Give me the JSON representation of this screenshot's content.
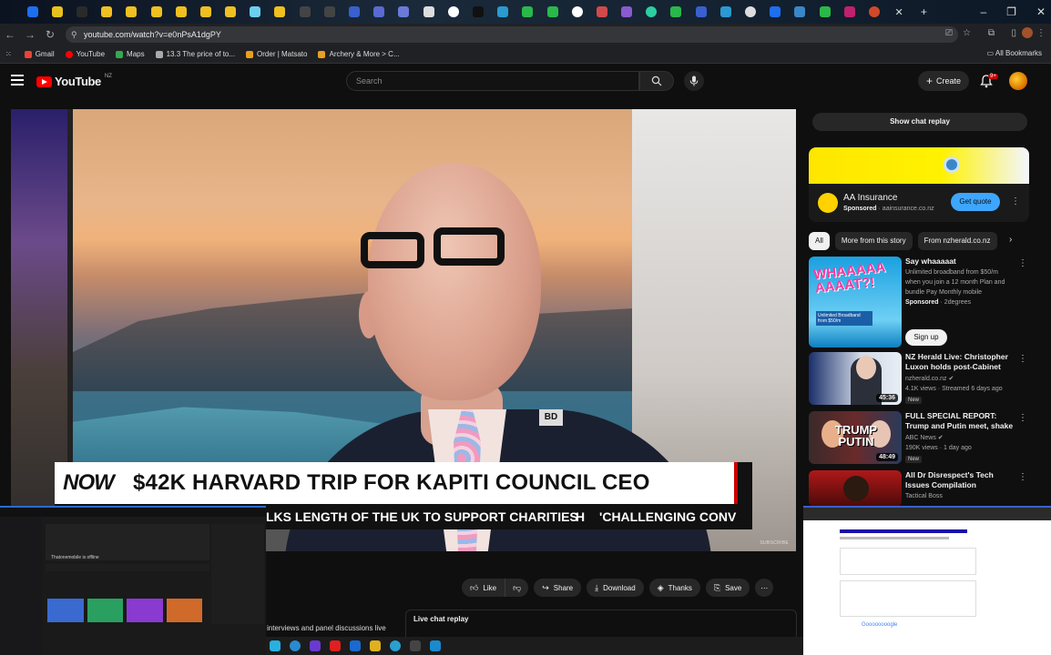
{
  "browser": {
    "url": "youtube.com/watch?v=e0nPsA1dgPY",
    "bookmarks": [
      "Gmail",
      "YouTube",
      "Maps",
      "13.3 The price of to...",
      "Order | Matsato",
      "Archery & More > C..."
    ],
    "all_bookmarks": "All Bookmarks"
  },
  "header": {
    "logo": "YouTube",
    "region": "NZ",
    "search_placeholder": "Search",
    "create_label": "Create",
    "notifications_badge": "9+"
  },
  "video": {
    "badge": "NOW",
    "headline": "$42K HARVARD TRIP FOR KAPITI COUNCIL CEO",
    "ticker_a": "LKS LENGTH OF THE UK TO SUPPORT CHARITIES",
    "ticker_b": "'CHALLENGING CONV",
    "ticker_logo": "H",
    "subscribe_label": "SUBSCRIBE",
    "jacket_badge": "BD"
  },
  "actions": {
    "like": "Like",
    "share": "Share",
    "download": "Download",
    "thanks": "Thanks",
    "save": "Save"
  },
  "below_video": {
    "discussion_snippet": "interviews and panel discussions live",
    "live_chat_title": "Live chat replay"
  },
  "sidebar": {
    "show_chat_replay": "Show chat replay",
    "ad": {
      "title": "AA Insurance",
      "sponsored": "Sponsored",
      "domain": "aainsurance.co.nz",
      "cta": "Get quote"
    },
    "chips": [
      "All",
      "More from this story",
      "From nzherald.co.nz"
    ],
    "recommendations": [
      {
        "title": "Say whaaaaat",
        "line1": "Unlimited broadband from $50/m",
        "line2": "when you join a 12 month Plan and",
        "line3": "bundle Pay Monthly mobile",
        "sponsored": "Sponsored",
        "advertiser": "2degrees",
        "cta": "Sign up",
        "thumb_text": "WHAAAAA AAAAT?!",
        "thumb_sub": "Unlimited Broadband from $50/m"
      },
      {
        "title": "NZ Herald Live: Christopher Luxon holds post-Cabinet pres...",
        "channel": "nzherald.co.nz",
        "meta": "4.1K views · Streamed 6 days ago",
        "badge": "New",
        "duration": "45:36"
      },
      {
        "title": "FULL SPECIAL REPORT: Trump and Putin meet, shake hands i...",
        "channel": "ABC News",
        "meta": "190K views · 1 day ago",
        "badge": "New",
        "duration": "48:49",
        "thumb_text": "TRUMP PUTIN"
      },
      {
        "title": "All Dr Disrespect's Tech Issues Compilation",
        "channel": "Tactical Boss",
        "meta": "",
        "badge": "",
        "duration": ""
      }
    ]
  },
  "overlays": {
    "left_label": "Thatonemobile is offline",
    "right_search": "Goooooooogle"
  },
  "colors": {
    "youtube_red": "#ff0000",
    "accent_blue": "#3ea6ff",
    "bg": "#0f0f0f",
    "pill": "#272727"
  }
}
